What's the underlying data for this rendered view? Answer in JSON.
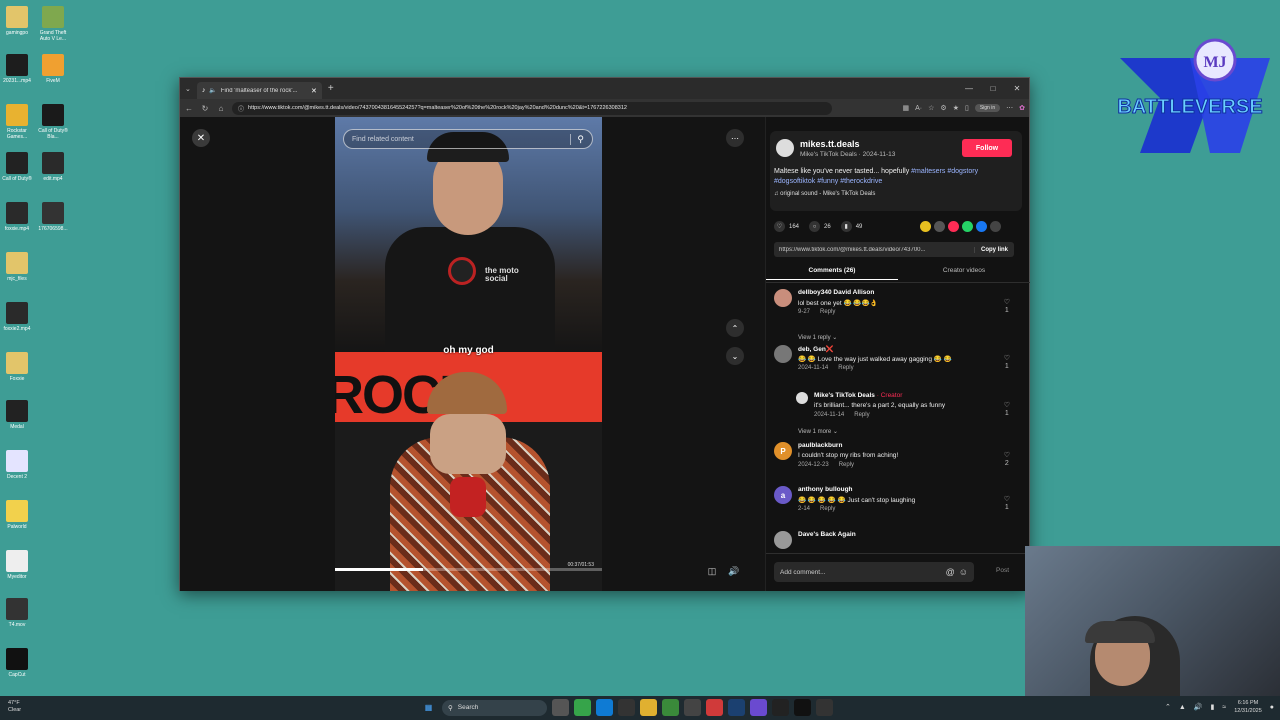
{
  "desktop": {
    "icons": [
      {
        "label": "gamingpo",
        "color": "#e2c56a"
      },
      {
        "label": "Grand Theft Auto V Le...",
        "color": "#7fa84e"
      },
      {
        "label": "20231...mp4",
        "color": "#1d1d1d"
      },
      {
        "label": "FiveM",
        "color": "#f0a030"
      },
      {
        "label": "Rockstar Games...",
        "color": "#e8b230"
      },
      {
        "label": "Call of Duty® Bla...",
        "color": "#1a1a1a"
      },
      {
        "label": "Call of Duty®",
        "color": "#222"
      },
      {
        "label": "edit.mp4",
        "color": "#2a2a2a"
      },
      {
        "label": "foxxie.mp4",
        "color": "#2a2a2a"
      },
      {
        "label": "176706598...",
        "color": "#333"
      },
      {
        "label": "mjc_files",
        "color": "#e2c56a"
      },
      {
        "label": "foxxie2.mp4",
        "color": "#2a2a2a"
      },
      {
        "label": "Foxxie",
        "color": "#e2c56a"
      },
      {
        "label": "Medal",
        "color": "#222"
      },
      {
        "label": "Decent 2",
        "color": "#e4e4ff"
      },
      {
        "label": "Palworld",
        "color": "#f2d14c"
      },
      {
        "label": "Myeditor",
        "color": "#eee"
      },
      {
        "label": "T4.mov",
        "color": "#333"
      },
      {
        "label": "CapCut",
        "color": "#111"
      }
    ]
  },
  "logo": {
    "initials": "MJ",
    "text": "BATTLEVERSE"
  },
  "browser": {
    "tab_title": "Find 'malteaser of the rock'...",
    "new_tab": "+",
    "url": "https://www.tiktok.com/@mikes.tt.deals/video/7437004381645524257?q=malteaser%20of%20the%20rock%20jay%20and%20dunc%20&t=1767226308312",
    "sign_in": "Sign in"
  },
  "video": {
    "search_placeholder": "Find related content",
    "caption": "oh my god",
    "timecode": "00:37/01:53",
    "progress": 0.33,
    "shirt_logo": "the moto social",
    "bg_word": "ROCK"
  },
  "post": {
    "username": "mikes.tt.deals",
    "subtitle": "Mike's TikTok Deals · 2024-11-13",
    "follow_label": "Follow",
    "description": "Maltese like you've never tasted... hopefully ",
    "tags": [
      "#maltesers",
      "#dogstory",
      "#dogsoftiktok",
      "#funny",
      "#therockdrive"
    ],
    "sound": "original sound - Mike's TikTok Deals",
    "likes": "164",
    "comments": "26",
    "saves": "49",
    "link": "https://www.tiktok.com/@mikes.tt.deals/video/743700...",
    "copy_label": "Copy link",
    "tab_comments": "Comments (26)",
    "tab_creator": "Creator videos"
  },
  "comments": [
    {
      "name": "dellboy340 David Allison",
      "text": "lol best one yet 😂 😂😂👌",
      "date": "9-27",
      "reply": "Reply",
      "likes": "1",
      "avatar": "#c98e7c",
      "initial": ""
    },
    {
      "name": "deb, Gen❌",
      "text": "😂 😂 Love the way just walked away gagging 😂 😂",
      "date": "2024-11-14",
      "reply": "Reply",
      "likes": "1",
      "avatar": "#777",
      "initial": ""
    },
    {
      "name": "paulblackburn",
      "text": "I couldn't stop my ribs from aching!",
      "date": "2024-12-23",
      "reply": "Reply",
      "likes": "2",
      "avatar": "#e0902a",
      "initial": "P"
    },
    {
      "name": "anthony bullough",
      "text": "😂 😂 😂 😂 😂 Just can't stop laughing",
      "date": "2-14",
      "reply": "Reply",
      "likes": "1",
      "avatar": "#6a5ac8",
      "initial": "a"
    },
    {
      "name": "Dave's Back Again",
      "text": "",
      "date": "",
      "reply": "",
      "likes": "",
      "avatar": "#999",
      "initial": ""
    }
  ],
  "creator_reply": {
    "name": "Mike's TikTok Deals",
    "badge": "· Creator",
    "text": "it's brilliant... there's a part 2, equally as funny",
    "date": "2024-11-14",
    "reply": "Reply",
    "likes": "1"
  },
  "view_reply": "View 1 reply",
  "view_more": "View 1 more",
  "add_comment": {
    "placeholder": "Add comment...",
    "post_label": "Post"
  },
  "taskbar": {
    "weather_temp": "47°F",
    "weather_desc": "Clear",
    "search_label": "Search",
    "time": "6:16 PM",
    "date": "12/31/2025"
  }
}
